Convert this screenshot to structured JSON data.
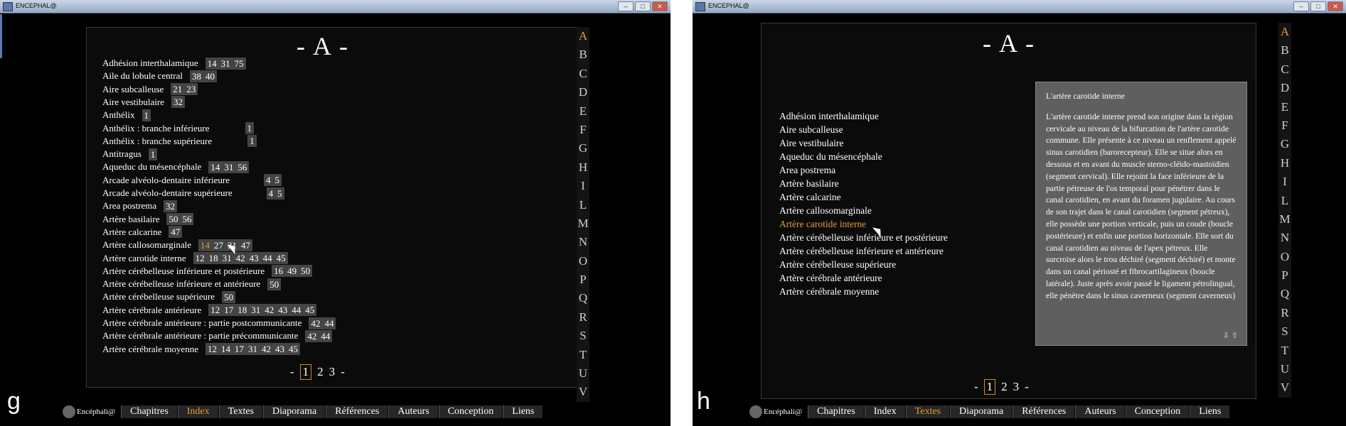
{
  "panel_g": {
    "window_title": "ENCEPHAL@",
    "heading": "- A -",
    "alphabet": [
      "A",
      "B",
      "C",
      "D",
      "E",
      "F",
      "G",
      "H",
      "I",
      "L",
      "M",
      "N",
      "O",
      "P",
      "Q",
      "R",
      "S",
      "T",
      "U",
      "V"
    ],
    "active_letter": "A",
    "entries": [
      {
        "term": "Adhésion interthalamique",
        "pages": [
          "14",
          "31",
          "75"
        ]
      },
      {
        "term": "Aile du lobule central",
        "pages": [
          "38",
          "40"
        ]
      },
      {
        "term": "Aire subcalleuse",
        "pages": [
          "21",
          "23"
        ]
      },
      {
        "term": "Aire vestibulaire",
        "pages": [
          "32"
        ]
      },
      {
        "term": "Anthélix",
        "pages": [
          "1"
        ]
      },
      {
        "term": "Anthélix : branche inférieure",
        "pages": [
          "1"
        ]
      },
      {
        "term": "Anthélix : branche supérieure",
        "pages": [
          "1"
        ]
      },
      {
        "term": "Antitragus",
        "pages": [
          "1"
        ]
      },
      {
        "term": "Aqueduc du mésencéphale",
        "pages": [
          "14",
          "31",
          "56"
        ]
      },
      {
        "term": "Arcade alvéolo-dentaire inférieure",
        "pages": [
          "4",
          "5"
        ]
      },
      {
        "term": "Arcade alvéolo-dentaire supérieure",
        "pages": [
          "4",
          "5"
        ]
      },
      {
        "term": "Area postrema",
        "pages": [
          "32"
        ]
      },
      {
        "term": "Artère basilaire",
        "pages": [
          "50",
          "56"
        ]
      },
      {
        "term": "Artère calcarine",
        "pages": [
          "47"
        ]
      },
      {
        "term": "Artère callosomarginale",
        "pages": [
          "14",
          "27",
          "31",
          "47"
        ]
      },
      {
        "term": "Artère carotide interne",
        "pages": [
          "12",
          "18",
          "31",
          "42",
          "43",
          "44",
          "45"
        ]
      },
      {
        "term": "Artère cérébelleuse inférieure et postérieure",
        "pages": [
          "16",
          "49",
          "50"
        ]
      },
      {
        "term": "Artère cérébelleuse inférieure et antérieure",
        "pages": [
          "50"
        ]
      },
      {
        "term": "Artère cérébelleuse supérieure",
        "pages": [
          "50"
        ]
      },
      {
        "term": "Artère cérébrale antérieure",
        "pages": [
          "12",
          "17",
          "18",
          "31",
          "42",
          "43",
          "44",
          "45"
        ]
      },
      {
        "term": "Artère cérébrale antérieure : partie postcommunicante",
        "pages": [
          "42",
          "44"
        ]
      },
      {
        "term": "Artère cérébrale antérieure : partie précommunicante",
        "pages": [
          "42",
          "44"
        ]
      },
      {
        "term": "Artère cérébrale moyenne",
        "pages": [
          "12",
          "14",
          "17",
          "31",
          "42",
          "43",
          "45"
        ]
      }
    ],
    "highlighted_page": "14",
    "pager": {
      "prev": "-",
      "pages": [
        "1",
        "2",
        "3"
      ],
      "current": "1",
      "next": "-"
    },
    "nav": {
      "logo": "Encéphali@",
      "items": [
        "Chapitres",
        "Index",
        "Textes",
        "Diaporama",
        "Références",
        "Auteurs",
        "Conception",
        "Liens"
      ],
      "active": "Index"
    },
    "label": "g"
  },
  "panel_h": {
    "window_title": "ENCEPHAL@",
    "heading": "- A -",
    "alphabet": [
      "A",
      "B",
      "C",
      "D",
      "E",
      "F",
      "G",
      "H",
      "I",
      "L",
      "M",
      "N",
      "O",
      "P",
      "Q",
      "R",
      "S",
      "T",
      "U",
      "V"
    ],
    "active_letter": "A",
    "terms": [
      "Adhésion interthalamique",
      "Aire subcalleuse",
      "Aire vestibulaire",
      "Aqueduc du mésencéphale",
      "Area postrema",
      "Artère basilaire",
      "Artère calcarine",
      "Artère callosomarginale",
      "Artère carotide interne",
      "Artère cérébelleuse inférieure et postérieure",
      "Artère cérébelleuse inférieure et antérieure",
      "Artère cérébelleuse supérieure",
      "Artère cérébrale antérieure",
      "Artère cérébrale moyenne"
    ],
    "selected_term": "Artère carotide interne",
    "popup": {
      "title": "L'artère carotide interne",
      "body": "L'artère carotide interne prend son origine dans la région cervicale au niveau de la bifurcation de l'artère carotide commune. Elle présente à ce niveau un renflement appelé sinus carotidien (barorecepteur). Elle se situe alors en dessous et en avant du muscle sterno-cléido-mastoïdien (segment cervical). Elle rejoint la face inférieure de la partie pétreuse de l'os temporal pour pénétrer dans le canal carotidien, en avant du foramen jugulaire. Au cours de son trajet dans le canal carotidien (segment pétreux), elle possède une portion verticale, puis un coude (boucle postérieure) et enfin une portion horizontale. Elle sort du canal carotidien au niveau de l'apex pétreux. Elle surcroise alors le trou déchiré (segment déchiré) et monte dans un canal périosté et fibrocartilagineux (boucle latérale). Juste après avoir passé le ligament pétrolingual, elle pénètre dans le sinus caverneux (segment caverneux)",
      "arrows": "⇩ ⇧"
    },
    "pager": {
      "prev": "-",
      "pages": [
        "1",
        "2",
        "3"
      ],
      "current": "1",
      "next": "-"
    },
    "nav": {
      "logo": "Encéphali@",
      "items": [
        "Chapitres",
        "Index",
        "Textes",
        "Diaporama",
        "Références",
        "Auteurs",
        "Conception",
        "Liens"
      ],
      "active": "Textes"
    },
    "label": "h"
  }
}
